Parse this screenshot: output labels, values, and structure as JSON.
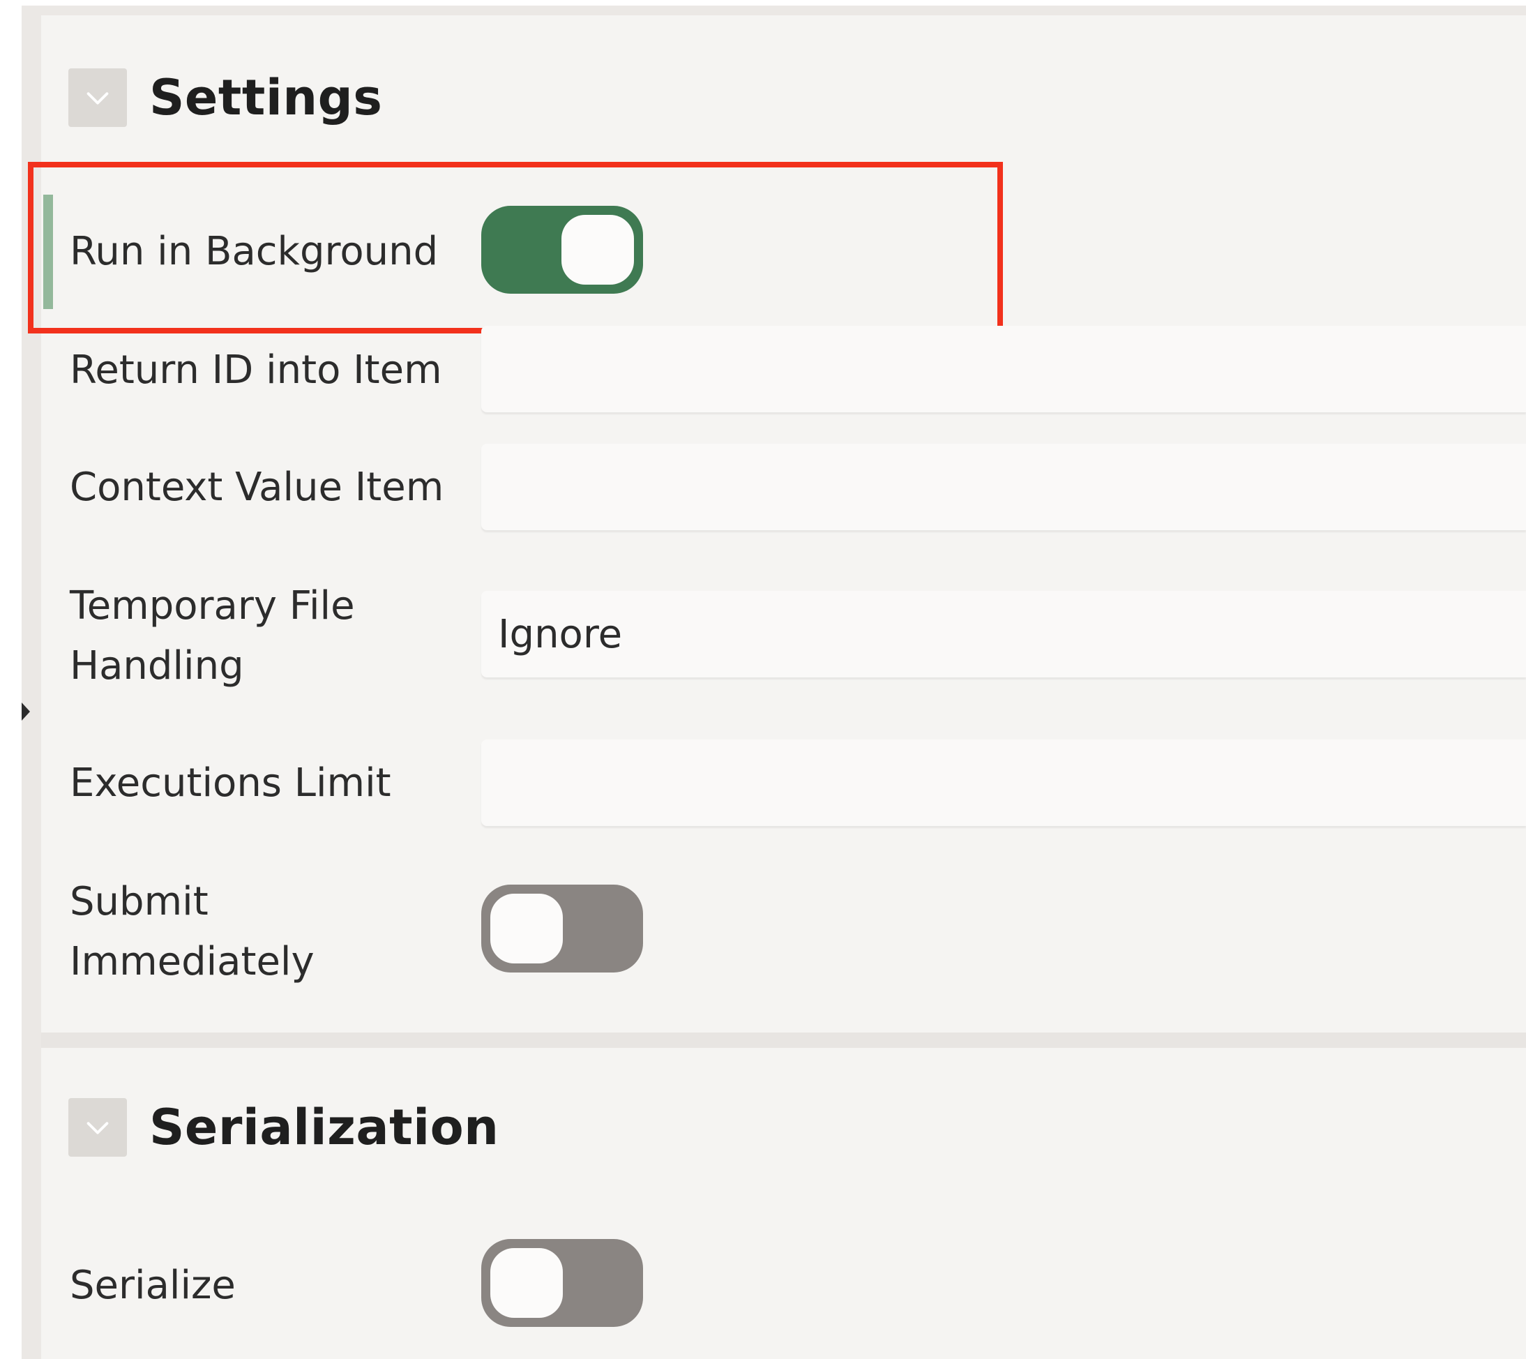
{
  "sections": {
    "settings": {
      "title": "Settings",
      "toggle_icon": "chevron-down-icon",
      "rows": {
        "run_in_background": {
          "label": "Run in Background",
          "value": true
        },
        "return_id_into_item": {
          "label": "Return ID into Item",
          "value": ""
        },
        "context_value_item": {
          "label": "Context Value Item",
          "value": ""
        },
        "temporary_file_handling": {
          "label_line1": "Temporary File",
          "label_line2": "Handling",
          "value": "Ignore"
        },
        "executions_limit": {
          "label": "Executions Limit",
          "value": ""
        },
        "submit_immediately": {
          "label_line1": "Submit",
          "label_line2": "Immediately",
          "value": false
        }
      }
    },
    "serialization": {
      "title": "Serialization",
      "toggle_icon": "chevron-down-icon",
      "rows": {
        "serialize": {
          "label": "Serialize",
          "value": false
        }
      }
    }
  },
  "colors": {
    "toggle_on": "#3f7a52",
    "toggle_off": "#8a8582",
    "highlight": "#f2311c",
    "accent": "#93b89b"
  }
}
